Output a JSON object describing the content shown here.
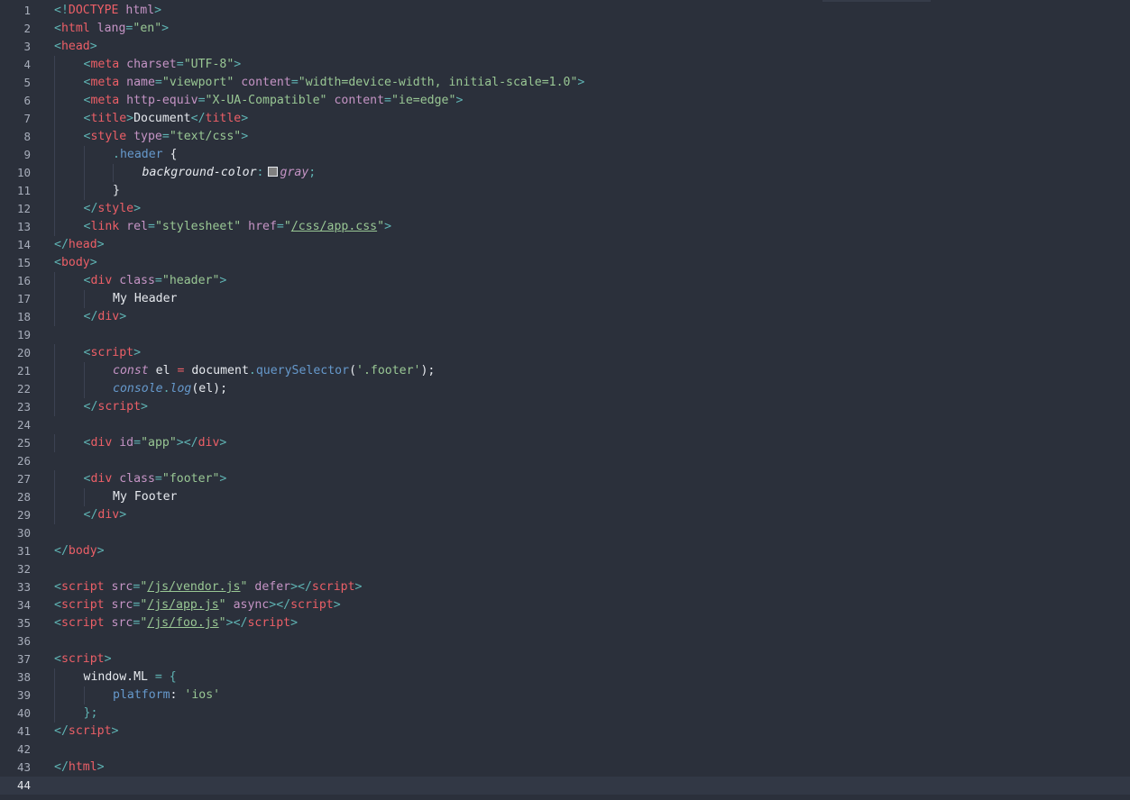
{
  "editor": {
    "active_line": 44,
    "colors": {
      "background": "#2b303b",
      "line_number": "#a7adba",
      "punctuation": "#5fb3b3",
      "tag": "#ec5f67",
      "attribute": "#c594c5",
      "string": "#99c794",
      "text": "#e6e9ee",
      "function": "#6699cc",
      "swatch_gray": "#808080"
    },
    "lines": [
      {
        "n": "1",
        "indent": 0,
        "tokens": [
          [
            "<!",
            "punct"
          ],
          [
            "DOCTYPE",
            "tag"
          ],
          [
            " html",
            "attr"
          ],
          [
            ">",
            "punct"
          ]
        ]
      },
      {
        "n": "2",
        "indent": 0,
        "tokens": [
          [
            "<",
            "punct"
          ],
          [
            "html",
            "tag"
          ],
          [
            " lang",
            "attr"
          ],
          [
            "=",
            "punct"
          ],
          [
            "\"en\"",
            "str"
          ],
          [
            ">",
            "punct"
          ]
        ]
      },
      {
        "n": "3",
        "indent": 0,
        "tokens": [
          [
            "<",
            "punct"
          ],
          [
            "head",
            "tag"
          ],
          [
            ">",
            "punct"
          ]
        ]
      },
      {
        "n": "4",
        "indent": 1,
        "tokens": [
          [
            "<",
            "punct"
          ],
          [
            "meta",
            "tag"
          ],
          [
            " charset",
            "attr"
          ],
          [
            "=",
            "punct"
          ],
          [
            "\"UTF-8\"",
            "str"
          ],
          [
            ">",
            "punct"
          ]
        ]
      },
      {
        "n": "5",
        "indent": 1,
        "tokens": [
          [
            "<",
            "punct"
          ],
          [
            "meta",
            "tag"
          ],
          [
            " name",
            "attr"
          ],
          [
            "=",
            "punct"
          ],
          [
            "\"viewport\"",
            "str"
          ],
          [
            " content",
            "attr"
          ],
          [
            "=",
            "punct"
          ],
          [
            "\"width=device-width, initial-scale=1.0\"",
            "str"
          ],
          [
            ">",
            "punct"
          ]
        ]
      },
      {
        "n": "6",
        "indent": 1,
        "tokens": [
          [
            "<",
            "punct"
          ],
          [
            "meta",
            "tag"
          ],
          [
            " http-equiv",
            "attr"
          ],
          [
            "=",
            "punct"
          ],
          [
            "\"X-UA-Compatible\"",
            "str"
          ],
          [
            " content",
            "attr"
          ],
          [
            "=",
            "punct"
          ],
          [
            "\"ie=edge\"",
            "str"
          ],
          [
            ">",
            "punct"
          ]
        ]
      },
      {
        "n": "7",
        "indent": 1,
        "tokens": [
          [
            "<",
            "punct"
          ],
          [
            "title",
            "tag"
          ],
          [
            ">",
            "punct"
          ],
          [
            "Document",
            "text"
          ],
          [
            "</",
            "punct"
          ],
          [
            "title",
            "tag"
          ],
          [
            ">",
            "punct"
          ]
        ]
      },
      {
        "n": "8",
        "indent": 1,
        "tokens": [
          [
            "<",
            "punct"
          ],
          [
            "style",
            "tag"
          ],
          [
            " type",
            "attr"
          ],
          [
            "=",
            "punct"
          ],
          [
            "\"text/css\"",
            "str"
          ],
          [
            ">",
            "punct"
          ]
        ]
      },
      {
        "n": "9",
        "indent": 2,
        "tokens": [
          [
            ".",
            "punct"
          ],
          [
            "header",
            "fn"
          ],
          [
            " {",
            "text"
          ]
        ]
      },
      {
        "n": "10",
        "indent": 3,
        "tokens": [
          [
            "background-color",
            "prop"
          ],
          [
            ":",
            "punct"
          ],
          [
            "",
            "swatch"
          ],
          [
            "gray",
            "val"
          ],
          [
            ";",
            "punct"
          ]
        ]
      },
      {
        "n": "11",
        "indent": 2,
        "tokens": [
          [
            "}",
            "text"
          ]
        ]
      },
      {
        "n": "12",
        "indent": 1,
        "tokens": [
          [
            "</",
            "punct"
          ],
          [
            "style",
            "tag"
          ],
          [
            ">",
            "punct"
          ]
        ]
      },
      {
        "n": "13",
        "indent": 1,
        "tokens": [
          [
            "<",
            "punct"
          ],
          [
            "link",
            "tag"
          ],
          [
            " rel",
            "attr"
          ],
          [
            "=",
            "punct"
          ],
          [
            "\"stylesheet\"",
            "str"
          ],
          [
            " href",
            "attr"
          ],
          [
            "=",
            "punct"
          ],
          [
            "\"",
            "str"
          ],
          [
            "/css/app.css",
            "url"
          ],
          [
            "\"",
            "str"
          ],
          [
            ">",
            "punct"
          ]
        ]
      },
      {
        "n": "14",
        "indent": 0,
        "tokens": [
          [
            "</",
            "punct"
          ],
          [
            "head",
            "tag"
          ],
          [
            ">",
            "punct"
          ]
        ]
      },
      {
        "n": "15",
        "indent": 0,
        "tokens": [
          [
            "<",
            "punct"
          ],
          [
            "body",
            "tag"
          ],
          [
            ">",
            "punct"
          ]
        ]
      },
      {
        "n": "16",
        "indent": 1,
        "tokens": [
          [
            "<",
            "punct"
          ],
          [
            "div",
            "tag"
          ],
          [
            " class",
            "attr"
          ],
          [
            "=",
            "punct"
          ],
          [
            "\"header\"",
            "str"
          ],
          [
            ">",
            "punct"
          ]
        ]
      },
      {
        "n": "17",
        "indent": 2,
        "tokens": [
          [
            "My Header",
            "text"
          ]
        ]
      },
      {
        "n": "18",
        "indent": 1,
        "tokens": [
          [
            "</",
            "punct"
          ],
          [
            "div",
            "tag"
          ],
          [
            ">",
            "punct"
          ]
        ]
      },
      {
        "n": "19",
        "indent": 0,
        "tokens": []
      },
      {
        "n": "20",
        "indent": 1,
        "tokens": [
          [
            "<",
            "punct"
          ],
          [
            "script",
            "tag"
          ],
          [
            ">",
            "punct"
          ]
        ]
      },
      {
        "n": "21",
        "indent": 2,
        "tokens": [
          [
            "const",
            "kw"
          ],
          [
            " el ",
            "text"
          ],
          [
            "=",
            "tag"
          ],
          [
            " document",
            "text"
          ],
          [
            ".",
            "punct"
          ],
          [
            "querySelector",
            "fn"
          ],
          [
            "(",
            "text"
          ],
          [
            "'.footer'",
            "str"
          ],
          [
            ");",
            "text"
          ]
        ]
      },
      {
        "n": "22",
        "indent": 2,
        "tokens": [
          [
            "console",
            "italic-fn"
          ],
          [
            ".",
            "punct"
          ],
          [
            "log",
            "italic-fn"
          ],
          [
            "(el);",
            "text"
          ]
        ]
      },
      {
        "n": "23",
        "indent": 1,
        "tokens": [
          [
            "</",
            "punct"
          ],
          [
            "script",
            "tag"
          ],
          [
            ">",
            "punct"
          ]
        ]
      },
      {
        "n": "24",
        "indent": 0,
        "tokens": []
      },
      {
        "n": "25",
        "indent": 1,
        "tokens": [
          [
            "<",
            "punct"
          ],
          [
            "div",
            "tag"
          ],
          [
            " id",
            "attr"
          ],
          [
            "=",
            "punct"
          ],
          [
            "\"app\"",
            "str"
          ],
          [
            "></",
            "punct"
          ],
          [
            "div",
            "tag"
          ],
          [
            ">",
            "punct"
          ]
        ]
      },
      {
        "n": "26",
        "indent": 0,
        "tokens": []
      },
      {
        "n": "27",
        "indent": 1,
        "tokens": [
          [
            "<",
            "punct"
          ],
          [
            "div",
            "tag"
          ],
          [
            " class",
            "attr"
          ],
          [
            "=",
            "punct"
          ],
          [
            "\"footer\"",
            "str"
          ],
          [
            ">",
            "punct"
          ]
        ]
      },
      {
        "n": "28",
        "indent": 2,
        "tokens": [
          [
            "My Footer",
            "text"
          ]
        ]
      },
      {
        "n": "29",
        "indent": 1,
        "tokens": [
          [
            "</",
            "punct"
          ],
          [
            "div",
            "tag"
          ],
          [
            ">",
            "punct"
          ]
        ]
      },
      {
        "n": "30",
        "indent": 0,
        "tokens": []
      },
      {
        "n": "31",
        "indent": 0,
        "tokens": [
          [
            "</",
            "punct"
          ],
          [
            "body",
            "tag"
          ],
          [
            ">",
            "punct"
          ]
        ]
      },
      {
        "n": "32",
        "indent": 0,
        "tokens": []
      },
      {
        "n": "33",
        "indent": 0,
        "tokens": [
          [
            "<",
            "punct"
          ],
          [
            "script",
            "tag"
          ],
          [
            " src",
            "attr"
          ],
          [
            "=",
            "punct"
          ],
          [
            "\"",
            "str"
          ],
          [
            "/js/vendor.js",
            "url"
          ],
          [
            "\"",
            "str"
          ],
          [
            " defer",
            "attr"
          ],
          [
            "></",
            "punct"
          ],
          [
            "script",
            "tag"
          ],
          [
            ">",
            "punct"
          ]
        ]
      },
      {
        "n": "34",
        "indent": 0,
        "tokens": [
          [
            "<",
            "punct"
          ],
          [
            "script",
            "tag"
          ],
          [
            " src",
            "attr"
          ],
          [
            "=",
            "punct"
          ],
          [
            "\"",
            "str"
          ],
          [
            "/js/app.js",
            "url"
          ],
          [
            "\"",
            "str"
          ],
          [
            " async",
            "attr"
          ],
          [
            "></",
            "punct"
          ],
          [
            "script",
            "tag"
          ],
          [
            ">",
            "punct"
          ]
        ]
      },
      {
        "n": "35",
        "indent": 0,
        "tokens": [
          [
            "<",
            "punct"
          ],
          [
            "script",
            "tag"
          ],
          [
            " src",
            "attr"
          ],
          [
            "=",
            "punct"
          ],
          [
            "\"",
            "str"
          ],
          [
            "/js/foo.js",
            "url"
          ],
          [
            "\"",
            "str"
          ],
          [
            "></",
            "punct"
          ],
          [
            "script",
            "tag"
          ],
          [
            ">",
            "punct"
          ]
        ]
      },
      {
        "n": "36",
        "indent": 0,
        "tokens": []
      },
      {
        "n": "37",
        "indent": 0,
        "tokens": [
          [
            "<",
            "punct"
          ],
          [
            "script",
            "tag"
          ],
          [
            ">",
            "punct"
          ]
        ]
      },
      {
        "n": "38",
        "indent": 1,
        "tokens": [
          [
            "window",
            "text"
          ],
          [
            ".",
            "text"
          ],
          [
            "ML",
            "text"
          ],
          [
            " = {",
            "punct"
          ]
        ]
      },
      {
        "n": "39",
        "indent": 2,
        "tokens": [
          [
            "platform",
            "key"
          ],
          [
            ": ",
            "text"
          ],
          [
            "'ios'",
            "str"
          ]
        ]
      },
      {
        "n": "40",
        "indent": 1,
        "tokens": [
          [
            "};",
            "punct"
          ]
        ]
      },
      {
        "n": "41",
        "indent": 0,
        "tokens": [
          [
            "</",
            "punct"
          ],
          [
            "script",
            "tag"
          ],
          [
            ">",
            "punct"
          ]
        ]
      },
      {
        "n": "42",
        "indent": 0,
        "tokens": []
      },
      {
        "n": "43",
        "indent": 0,
        "tokens": [
          [
            "</",
            "punct"
          ],
          [
            "html",
            "tag"
          ],
          [
            ">",
            "punct"
          ]
        ]
      },
      {
        "n": "44",
        "indent": 0,
        "tokens": []
      }
    ]
  }
}
